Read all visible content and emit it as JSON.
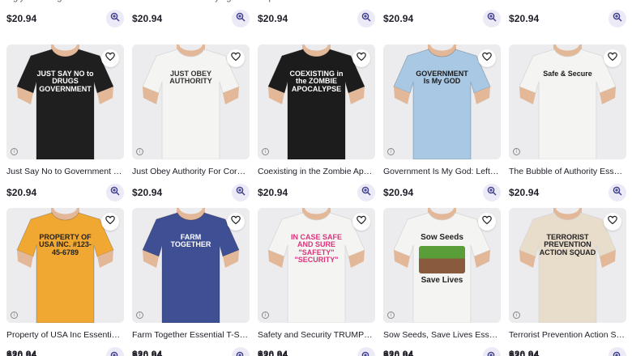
{
  "top_row": [
    {
      "title": "Ugly Sovereign Citizen Essenti...",
      "price": "$20.94"
    },
    {
      "title": "The Government is Lying Essen...",
      "price": "$20.94"
    },
    {
      "title": "Pop Tarts Essential T-Shirt",
      "price": "$20.94"
    },
    {
      "title": "Freedom is Not Permission Es...",
      "price": "$20.94"
    },
    {
      "title": "Faith Alone Is Essential Shirt",
      "price": "$20.94"
    }
  ],
  "row1": [
    {
      "title": "Just Say No to Government Ess...",
      "price": "$20.94",
      "shirt_color": "#1f1f1f",
      "print": "JUST SAY NO to DRUGS GOVERNMENT",
      "print_color": "#ffffff"
    },
    {
      "title": "Just Obey Authority For Coron...",
      "price": "$20.94",
      "shirt_color": "#f4f4f2",
      "print": "JUST OBEY AUTHORITY",
      "print_color": "#333333"
    },
    {
      "title": "Coexisting in the Zombie Apoc...",
      "price": "$20.94",
      "shirt_color": "#1c1c1c",
      "print": "COEXISTING in the ZOMBIE APOCALYPSE",
      "print_color": "#ffffff"
    },
    {
      "title": "Government Is My God: Left v...",
      "price": "$20.94",
      "shirt_color": "#a9c8e4",
      "print": "GOVERNMENT Is My GOD",
      "print_color": "#1a1a1a"
    },
    {
      "title": "The Bubble of Authority Essen...",
      "price": "$20.94",
      "shirt_color": "#f4f4f2",
      "print": "Safe & Secure",
      "print_color": "#1a1a1a"
    }
  ],
  "row2": [
    {
      "title": "Property of USA Inc Essential ...",
      "price": "$20.94",
      "shirt_color": "#f0a833",
      "print": "PROPERTY OF USA INC. #123-45-6789",
      "print_color": "#222222"
    },
    {
      "title": "Farm Together Essential T-Shirt",
      "price": "$20.94",
      "shirt_color": "#3e4f93",
      "print": "FARM TOGETHER",
      "print_color": "#ffffff"
    },
    {
      "title": "Safety and Security TRUMPS ...",
      "price": "$20.94",
      "shirt_color": "#f4f4f2",
      "print": "IN CASE SAFE AND SURE \"SAFETY\" \"SECURITY\"",
      "print_color": "#d9357a"
    },
    {
      "title": "Sow Seeds, Save Lives Essent...",
      "price": "$20.94",
      "shirt_color": "#f4f4f2",
      "print_top": "Sow Seeds",
      "print_bottom": "Save Lives",
      "print_color": "#222222"
    },
    {
      "title": "Terrorist Prevention Action Sq...",
      "price": "$20.94",
      "shirt_color": "#e8dccb",
      "print": "TERRORIST PREVENTION ACTION SQUAD",
      "print_color": "#222222"
    }
  ],
  "bottom_row": [
    {
      "price": "$20.94"
    },
    {
      "price": "$20.94"
    },
    {
      "price": "$20.94"
    },
    {
      "price": "$20.94"
    },
    {
      "price": "$20.94"
    }
  ],
  "icons": {
    "zoom": "zoom-in-icon",
    "favorite": "heart-icon",
    "info": "info-icon"
  },
  "colors": {
    "zoom_bg": "#eceaf6",
    "zoom_icon": "#3b3a8c",
    "price_text": "#1e1e28"
  }
}
